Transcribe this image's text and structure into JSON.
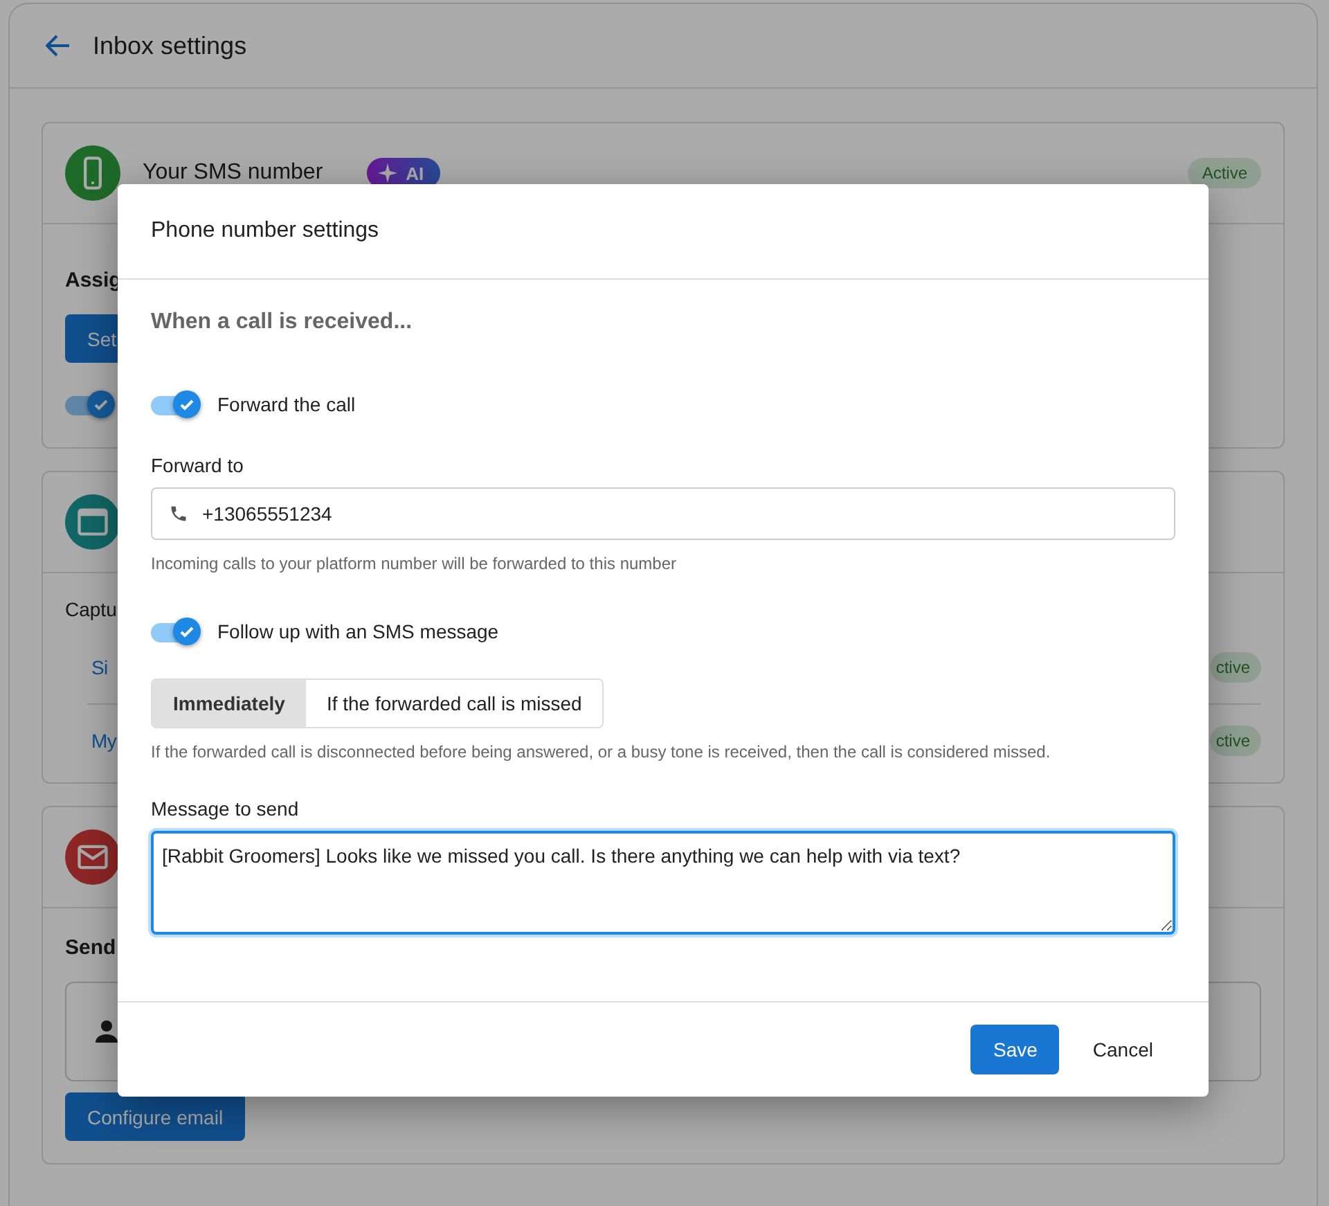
{
  "header": {
    "title": "Inbox settings"
  },
  "background_cards": [
    {
      "title": "Your SMS number",
      "ai_badge": "AI",
      "status": "Active",
      "section_title": "Assig",
      "button": "Set",
      "toggle_on": true
    },
    {
      "section_label": "Captu",
      "rows": [
        {
          "label": "Si",
          "status": "ctive"
        },
        {
          "label": "My",
          "status": "ctive"
        }
      ]
    },
    {
      "section_title": "Send",
      "button": "Configure email"
    }
  ],
  "dialog": {
    "title": "Phone number settings",
    "heading": "When a call is received...",
    "forward_toggle": {
      "label": "Forward the call",
      "on": true
    },
    "forward_to": {
      "label": "Forward to",
      "value": "+13065551234",
      "helper": "Incoming calls to your platform number will be forwarded to this number"
    },
    "sms_toggle": {
      "label": "Follow up with an SMS message",
      "on": true
    },
    "timing": [
      {
        "label": "Immediately",
        "selected": true
      },
      {
        "label": "If the forwarded call is missed",
        "selected": false
      }
    ],
    "timing_helper": "If the forwarded call is disconnected before being answered, or a busy tone is received, then the call is considered missed.",
    "message": {
      "label": "Message to send",
      "value": "[Rabbit Groomers] Looks like we missed you call. Is there anything we can help with via text?"
    },
    "buttons": [
      "Save",
      "Cancel"
    ]
  }
}
